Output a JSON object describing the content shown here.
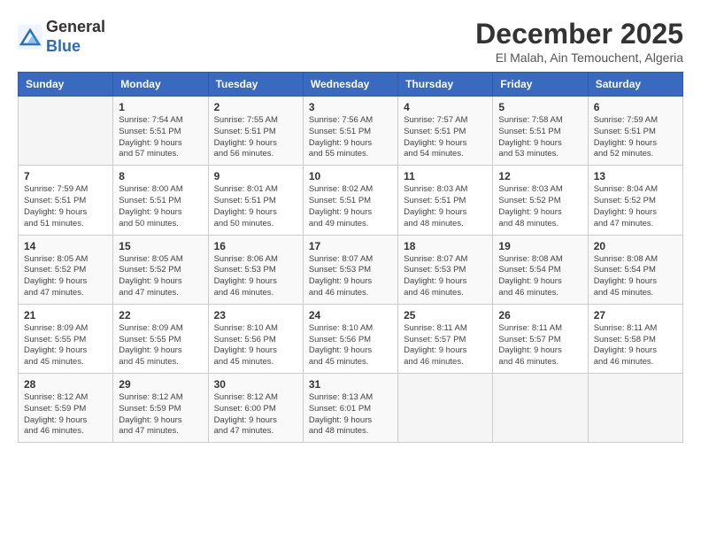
{
  "logo": {
    "general": "General",
    "blue": "Blue"
  },
  "title": "December 2025",
  "subtitle": "El Malah, Ain Temouchent, Algeria",
  "days_header": [
    "Sunday",
    "Monday",
    "Tuesday",
    "Wednesday",
    "Thursday",
    "Friday",
    "Saturday"
  ],
  "weeks": [
    [
      {
        "day": "",
        "info": ""
      },
      {
        "day": "1",
        "info": "Sunrise: 7:54 AM\nSunset: 5:51 PM\nDaylight: 9 hours\nand 57 minutes."
      },
      {
        "day": "2",
        "info": "Sunrise: 7:55 AM\nSunset: 5:51 PM\nDaylight: 9 hours\nand 56 minutes."
      },
      {
        "day": "3",
        "info": "Sunrise: 7:56 AM\nSunset: 5:51 PM\nDaylight: 9 hours\nand 55 minutes."
      },
      {
        "day": "4",
        "info": "Sunrise: 7:57 AM\nSunset: 5:51 PM\nDaylight: 9 hours\nand 54 minutes."
      },
      {
        "day": "5",
        "info": "Sunrise: 7:58 AM\nSunset: 5:51 PM\nDaylight: 9 hours\nand 53 minutes."
      },
      {
        "day": "6",
        "info": "Sunrise: 7:59 AM\nSunset: 5:51 PM\nDaylight: 9 hours\nand 52 minutes."
      }
    ],
    [
      {
        "day": "7",
        "info": "Sunrise: 7:59 AM\nSunset: 5:51 PM\nDaylight: 9 hours\nand 51 minutes."
      },
      {
        "day": "8",
        "info": "Sunrise: 8:00 AM\nSunset: 5:51 PM\nDaylight: 9 hours\nand 50 minutes."
      },
      {
        "day": "9",
        "info": "Sunrise: 8:01 AM\nSunset: 5:51 PM\nDaylight: 9 hours\nand 50 minutes."
      },
      {
        "day": "10",
        "info": "Sunrise: 8:02 AM\nSunset: 5:51 PM\nDaylight: 9 hours\nand 49 minutes."
      },
      {
        "day": "11",
        "info": "Sunrise: 8:03 AM\nSunset: 5:51 PM\nDaylight: 9 hours\nand 48 minutes."
      },
      {
        "day": "12",
        "info": "Sunrise: 8:03 AM\nSunset: 5:52 PM\nDaylight: 9 hours\nand 48 minutes."
      },
      {
        "day": "13",
        "info": "Sunrise: 8:04 AM\nSunset: 5:52 PM\nDaylight: 9 hours\nand 47 minutes."
      }
    ],
    [
      {
        "day": "14",
        "info": "Sunrise: 8:05 AM\nSunset: 5:52 PM\nDaylight: 9 hours\nand 47 minutes."
      },
      {
        "day": "15",
        "info": "Sunrise: 8:05 AM\nSunset: 5:52 PM\nDaylight: 9 hours\nand 47 minutes."
      },
      {
        "day": "16",
        "info": "Sunrise: 8:06 AM\nSunset: 5:53 PM\nDaylight: 9 hours\nand 46 minutes."
      },
      {
        "day": "17",
        "info": "Sunrise: 8:07 AM\nSunset: 5:53 PM\nDaylight: 9 hours\nand 46 minutes."
      },
      {
        "day": "18",
        "info": "Sunrise: 8:07 AM\nSunset: 5:53 PM\nDaylight: 9 hours\nand 46 minutes."
      },
      {
        "day": "19",
        "info": "Sunrise: 8:08 AM\nSunset: 5:54 PM\nDaylight: 9 hours\nand 46 minutes."
      },
      {
        "day": "20",
        "info": "Sunrise: 8:08 AM\nSunset: 5:54 PM\nDaylight: 9 hours\nand 45 minutes."
      }
    ],
    [
      {
        "day": "21",
        "info": "Sunrise: 8:09 AM\nSunset: 5:55 PM\nDaylight: 9 hours\nand 45 minutes."
      },
      {
        "day": "22",
        "info": "Sunrise: 8:09 AM\nSunset: 5:55 PM\nDaylight: 9 hours\nand 45 minutes."
      },
      {
        "day": "23",
        "info": "Sunrise: 8:10 AM\nSunset: 5:56 PM\nDaylight: 9 hours\nand 45 minutes."
      },
      {
        "day": "24",
        "info": "Sunrise: 8:10 AM\nSunset: 5:56 PM\nDaylight: 9 hours\nand 45 minutes."
      },
      {
        "day": "25",
        "info": "Sunrise: 8:11 AM\nSunset: 5:57 PM\nDaylight: 9 hours\nand 46 minutes."
      },
      {
        "day": "26",
        "info": "Sunrise: 8:11 AM\nSunset: 5:57 PM\nDaylight: 9 hours\nand 46 minutes."
      },
      {
        "day": "27",
        "info": "Sunrise: 8:11 AM\nSunset: 5:58 PM\nDaylight: 9 hours\nand 46 minutes."
      }
    ],
    [
      {
        "day": "28",
        "info": "Sunrise: 8:12 AM\nSunset: 5:59 PM\nDaylight: 9 hours\nand 46 minutes."
      },
      {
        "day": "29",
        "info": "Sunrise: 8:12 AM\nSunset: 5:59 PM\nDaylight: 9 hours\nand 47 minutes."
      },
      {
        "day": "30",
        "info": "Sunrise: 8:12 AM\nSunset: 6:00 PM\nDaylight: 9 hours\nand 47 minutes."
      },
      {
        "day": "31",
        "info": "Sunrise: 8:13 AM\nSunset: 6:01 PM\nDaylight: 9 hours\nand 48 minutes."
      },
      {
        "day": "",
        "info": ""
      },
      {
        "day": "",
        "info": ""
      },
      {
        "day": "",
        "info": ""
      }
    ]
  ]
}
